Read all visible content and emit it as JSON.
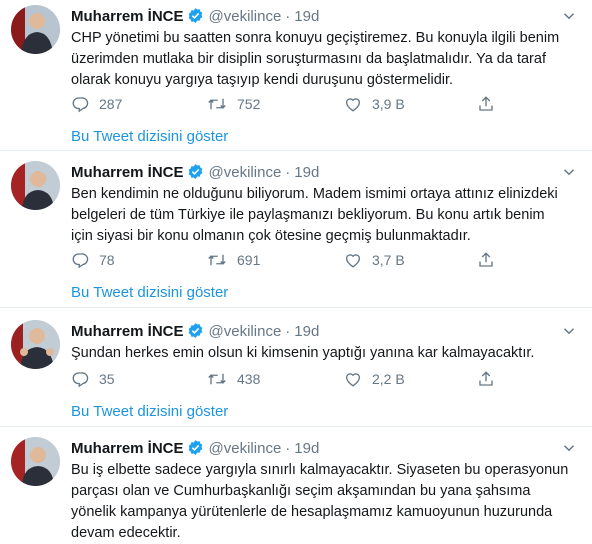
{
  "tweets": [
    {
      "name": "Muharrem İNCE",
      "handle": "@vekilince",
      "dot": "·",
      "time": "19d",
      "text": "CHP yönetimi bu saatten sonra konuyu geçiştiremez. Bu konuyla ilgili benim\nüzerimden mutlaka bir disiplin soruşturmasını da başlatmalıdır. Ya da  taraf\nolarak konuyu yargıya taşıyıp kendi duruşunu göstermelidir.",
      "replies": "287",
      "retweets": "752",
      "likes": "3,9 B",
      "show_thread": "Bu Tweet dizisini göster"
    },
    {
      "name": "Muharrem İNCE",
      "handle": "@vekilince",
      "dot": "·",
      "time": "19d",
      "text": "Ben kendimin ne olduğunu biliyorum. Madem ismimi ortaya attınız elinizdeki\nbelgeleri de tüm Türkiye ile paylaşmanızı bekliyorum.  Bu konu artık benim\niçin siyasi bir konu olmanın çok ötesine geçmiş bulunmaktadır.",
      "replies": "78",
      "retweets": "691",
      "likes": "3,7 B",
      "show_thread": "Bu Tweet dizisini göster"
    },
    {
      "name": "Muharrem İNCE",
      "handle": "@vekilince",
      "dot": "·",
      "time": "19d",
      "text": "Şundan herkes emin olsun ki kimsenin yaptığı yanına kar kalmayacaktır.",
      "replies": "35",
      "retweets": "438",
      "likes": "2,2 B",
      "show_thread": "Bu Tweet dizisini göster"
    },
    {
      "name": "Muharrem İNCE",
      "handle": "@vekilince",
      "dot": "·",
      "time": "19d",
      "text": "Bu iş elbette sadece yargıyla sınırlı kalmayacaktır. Siyaseten bu operasyonun\nparçası olan ve Cumhurbaşkanlığı seçim akşamından bu yana şahsıma\nyönelik kampanya yürütenlerle de hesaplaşmamız kamuoyunun huzurunda\ndevam edecektir."
    }
  ],
  "icons": {
    "verified": "verified-badge-icon",
    "caret": "chevron-down-icon",
    "reply": "reply-icon",
    "retweet": "retweet-icon",
    "like": "heart-icon",
    "share": "share-icon"
  },
  "colors": {
    "link": "#1b95e0",
    "muted": "#657786",
    "verified": "#1da1f2",
    "separator": "#e6ecf0"
  }
}
